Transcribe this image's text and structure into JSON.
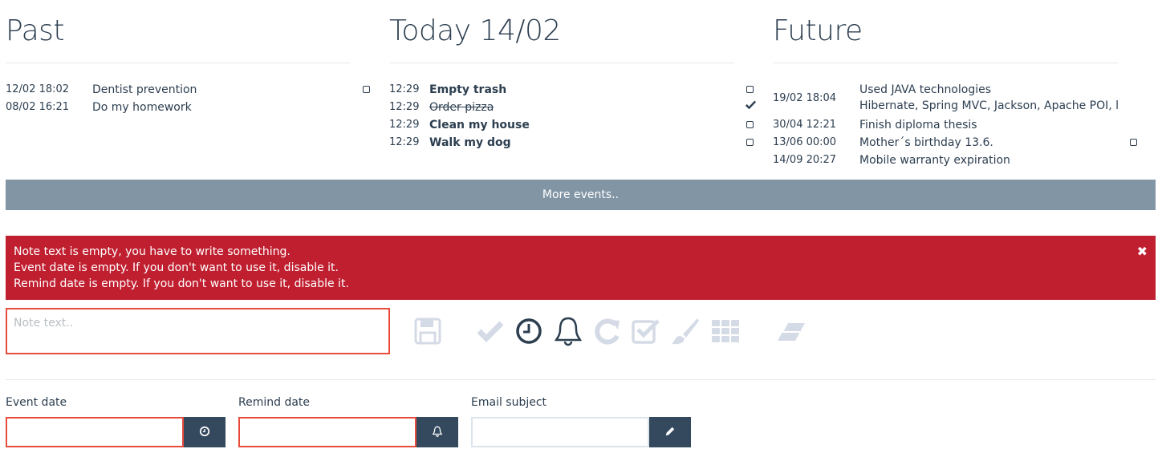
{
  "past": {
    "title": "Past",
    "events": [
      {
        "time": "12/02 18:02",
        "text": "Dentist prevention"
      },
      {
        "time": "08/02 16:21",
        "text": "Do my homework"
      }
    ]
  },
  "today": {
    "title": "Today 14/02",
    "events": [
      {
        "time": "12:29",
        "text": "Empty trash"
      },
      {
        "time": "12:29",
        "text": "Order pizza"
      },
      {
        "time": "12:29",
        "text": "Clean my house"
      },
      {
        "time": "12:29",
        "text": "Walk my dog"
      }
    ]
  },
  "future": {
    "title": "Future",
    "events": [
      {
        "time": "19/02 18:04",
        "line1": "Used JAVA technologies",
        "line2": "Hibernate, Spring MVC, Jackson, Apache POI, l"
      },
      {
        "time": "30/04 12:21",
        "text": "Finish diploma thesis"
      },
      {
        "time": "13/06 00:00",
        "text": "Mother´s birthday 13.6."
      },
      {
        "time": "14/09 20:27",
        "text": "Mobile warranty expiration"
      }
    ]
  },
  "more_events_label": "More events..",
  "alert": {
    "lines": [
      "Note text is empty, you have to write something.",
      "Event date is empty. If you don't want to use it, disable it.",
      "Remind date is empty. If you don't want to use it, disable it."
    ],
    "close": "✖"
  },
  "note": {
    "placeholder": "Note text.."
  },
  "toolbar": {
    "icons": [
      "save-icon",
      "check-icon",
      "clock-icon",
      "bell-icon",
      "redo-icon",
      "checkbox-icon",
      "brush-icon",
      "grid-icon",
      "eraser-icon"
    ]
  },
  "form": {
    "event_date_label": "Event date",
    "remind_date_label": "Remind date",
    "email_subject_label": "Email subject"
  },
  "colors": {
    "primary": "#2c3e50",
    "more_bar": "#8295a5",
    "alert": "#c01f30",
    "error_border": "#e74c3c",
    "button": "#34495e",
    "disabled_icon": "#d5dbe6"
  }
}
